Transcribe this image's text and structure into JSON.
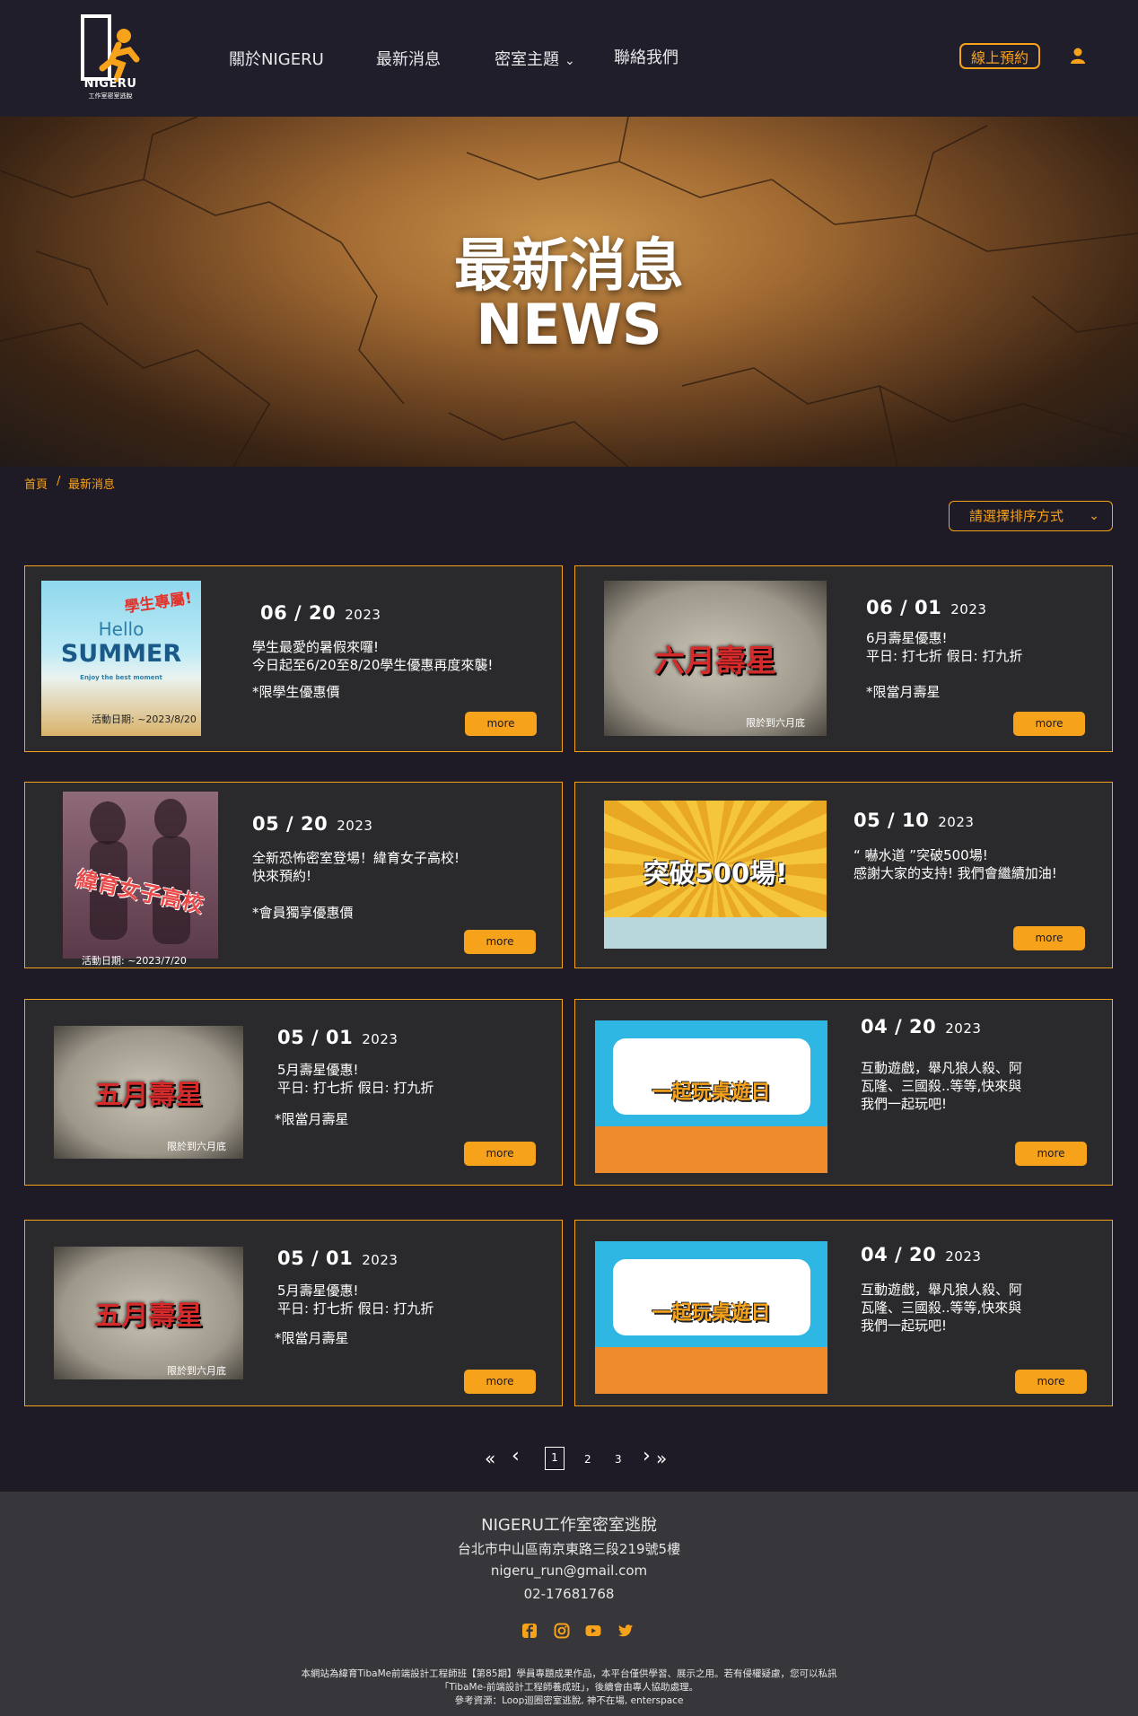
{
  "header": {
    "logo_text": "NIGERU",
    "logo_sub": "工作室密室逃脫",
    "nav": [
      "關於NIGERU",
      "最新消息",
      "密室主題",
      "聯絡我們"
    ],
    "book_label": "線上預約"
  },
  "hero": {
    "title_zh": "最新消息",
    "title_en": "NEWS"
  },
  "breadcrumb": {
    "home": "首頁",
    "sep": "/",
    "current": "最新消息"
  },
  "sort": {
    "label": "請選擇排序方式"
  },
  "cards": [
    {
      "date": "06 / 20",
      "year": "2023",
      "desc": "學生最愛的暑假來囉!\n今日起至6/20至8/20學生優惠再度來襲!",
      "note": "*限學生優惠價",
      "more": "more",
      "thumb": {
        "tag": "學生專屬!",
        "hello": "Hello",
        "summer": "SUMMER",
        "tagline": "Enjoy the best moment",
        "caption": "活動日期: ~2023/8/20"
      }
    },
    {
      "date": "06 / 01",
      "year": "2023",
      "desc": "6月壽星優惠!\n平日: 打七折   假日: 打九折",
      "note": "*限當月壽星",
      "more": "more",
      "thumb": {
        "big": "六月壽星",
        "caption": "限於到六月底"
      }
    },
    {
      "date": "05 / 20",
      "year": "2023",
      "desc": "全新恐怖密室登場！緯育女子高校!\n快來預約!",
      "note": "*會員獨享優惠價",
      "more": "more",
      "thumb": {
        "big": "緯育女子高校",
        "caption": "活動日期: ~2023/7/20"
      }
    },
    {
      "date": "05 / 10",
      "year": "2023",
      "desc": "“ 嚇水道 ”突破500場!\n感謝大家的支持! 我們會繼續加油!",
      "note": "",
      "more": "more",
      "thumb": {
        "big": "突破500場!"
      }
    },
    {
      "date": "05 / 01",
      "year": "2023",
      "desc": "5月壽星優惠!\n平日: 打七折   假日: 打九折",
      "note": "*限當月壽星",
      "more": "more",
      "thumb": {
        "big": "五月壽星",
        "caption": "限於到六月底"
      }
    },
    {
      "date": "04 / 20",
      "year": "2023",
      "desc": "互動遊戲，舉凡狼人殺、阿\n瓦隆、三國殺..等等,快來與\n我們一起玩吧!",
      "note": "",
      "more": "more",
      "thumb": {
        "big": "一起玩桌遊日"
      }
    },
    {
      "date": "05 / 01",
      "year": "2023",
      "desc": "5月壽星優惠!\n平日: 打七折   假日: 打九折",
      "note": "*限當月壽星",
      "more": "more",
      "thumb": {
        "big": "五月壽星",
        "caption": "限於到六月底"
      }
    },
    {
      "date": "04 / 20",
      "year": "2023",
      "desc": "互動遊戲，舉凡狼人殺、阿\n瓦隆、三國殺..等等,快來與\n我們一起玩吧!",
      "note": "",
      "more": "more",
      "thumb": {
        "big": "一起玩桌遊日"
      }
    }
  ],
  "pagination": {
    "first": "«",
    "prev": "‹",
    "pages": [
      "1",
      "2",
      "3"
    ],
    "next": "›",
    "last": "»"
  },
  "footer": {
    "name": "NIGERU工作室密室逃脫",
    "address": "台北市中山區南京東路三段219號5樓",
    "email": "nigeru_run@gmail.com",
    "phone": "02-17681768",
    "social_icons": [
      "facebook-icon",
      "instagram-icon",
      "youtube-icon",
      "twitter-icon"
    ],
    "disclaimer1": "本網站為緯育TibaMe前端設計工程師班【第85期】學員專題成果作品，本平台僅供學習、展示之用。若有侵權疑慮，您可以私訊",
    "disclaimer2": "「TibaMe-前端設計工程師養成班」，後續會由專人協助處理。",
    "disclaimer3": "參考資源：Loop迴圈密室逃脫, 神不在場, enterspace"
  },
  "colors": {
    "accent": "#f7a21b",
    "background": "#1e1b26",
    "card": "#2a2a2c",
    "footer": "#37363a"
  }
}
